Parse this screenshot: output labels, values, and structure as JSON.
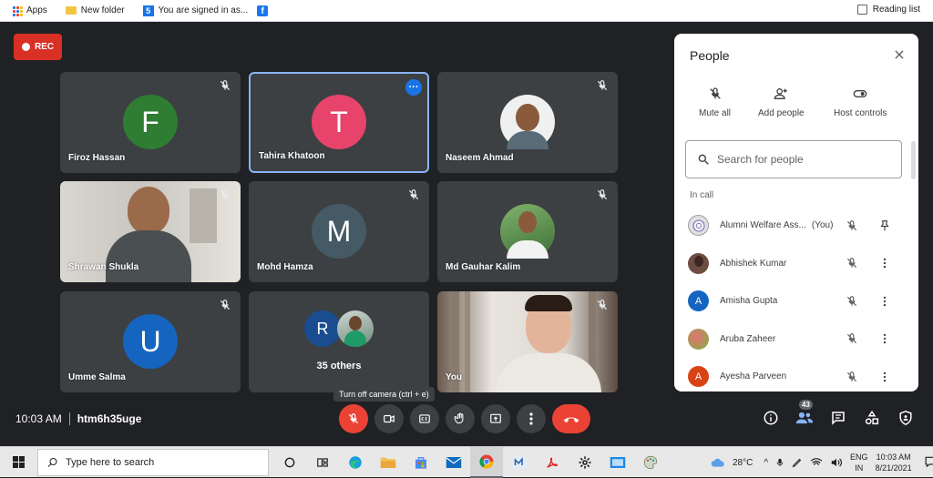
{
  "bookmarks": {
    "items": [
      {
        "label": "Apps",
        "icon": "apps-grid-icon"
      },
      {
        "label": "New folder",
        "icon": "folder-icon"
      },
      {
        "label": "You are signed in as...",
        "icon": "site-5-icon"
      },
      {
        "label": "",
        "icon": "facebook-icon"
      }
    ],
    "reading_list": "Reading list"
  },
  "meet": {
    "rec_label": "REC",
    "tiles": [
      {
        "name": "Firoz Hassan",
        "initial": "F",
        "color": "#2e7d32",
        "type": "avatar"
      },
      {
        "name": "Tahira Khatoon",
        "initial": "T",
        "color": "#e8436b",
        "type": "avatar",
        "active": true
      },
      {
        "name": "Naseem Ahmad",
        "initial": "",
        "type": "photo"
      },
      {
        "name": "Shrawan Shukla",
        "initial": "",
        "type": "video"
      },
      {
        "name": "Mohd Hamza",
        "initial": "M",
        "color": "#455a64",
        "type": "avatar"
      },
      {
        "name": "Md Gauhar Kalim",
        "initial": "",
        "type": "photo"
      },
      {
        "name": "Umme Salma",
        "initial": "U",
        "color": "#1565c0",
        "type": "avatar"
      },
      {
        "name": "35 others",
        "initial": "R",
        "color": "#1a4d8f",
        "type": "others"
      },
      {
        "name": "You",
        "initial": "",
        "type": "video"
      }
    ],
    "tooltip": "Turn off camera (ctrl + e)",
    "time": "10:03 AM",
    "meeting_code": "htm6h35uge",
    "people_badge": "43"
  },
  "panel": {
    "title": "People",
    "actions": [
      {
        "label": "Mute all",
        "icon": "mic-off-icon"
      },
      {
        "label": "Add people",
        "icon": "add-person-icon"
      },
      {
        "label": "Host controls",
        "icon": "toggle-icon"
      }
    ],
    "search_placeholder": "Search for people",
    "in_call": "In call",
    "participants": [
      {
        "name": "Alumni Welfare Ass...",
        "you": "(You)",
        "initial": "",
        "color": "#e0e0e0",
        "pin": true
      },
      {
        "name": "Abhishek Kumar",
        "initial": "",
        "color": "#6d4c41"
      },
      {
        "name": "Amisha Gupta",
        "initial": "A",
        "color": "#1565c0"
      },
      {
        "name": "Aruba Zaheer",
        "initial": "",
        "color": "#c62828"
      },
      {
        "name": "Ayesha Parveen",
        "initial": "A",
        "color": "#d84315"
      }
    ]
  },
  "taskbar": {
    "search_placeholder": "Type here to search",
    "weather": "28°C",
    "lang_top": "ENG",
    "lang_bottom": "IN",
    "time": "10:03 AM",
    "date": "8/21/2021",
    "notif_count": "2"
  }
}
